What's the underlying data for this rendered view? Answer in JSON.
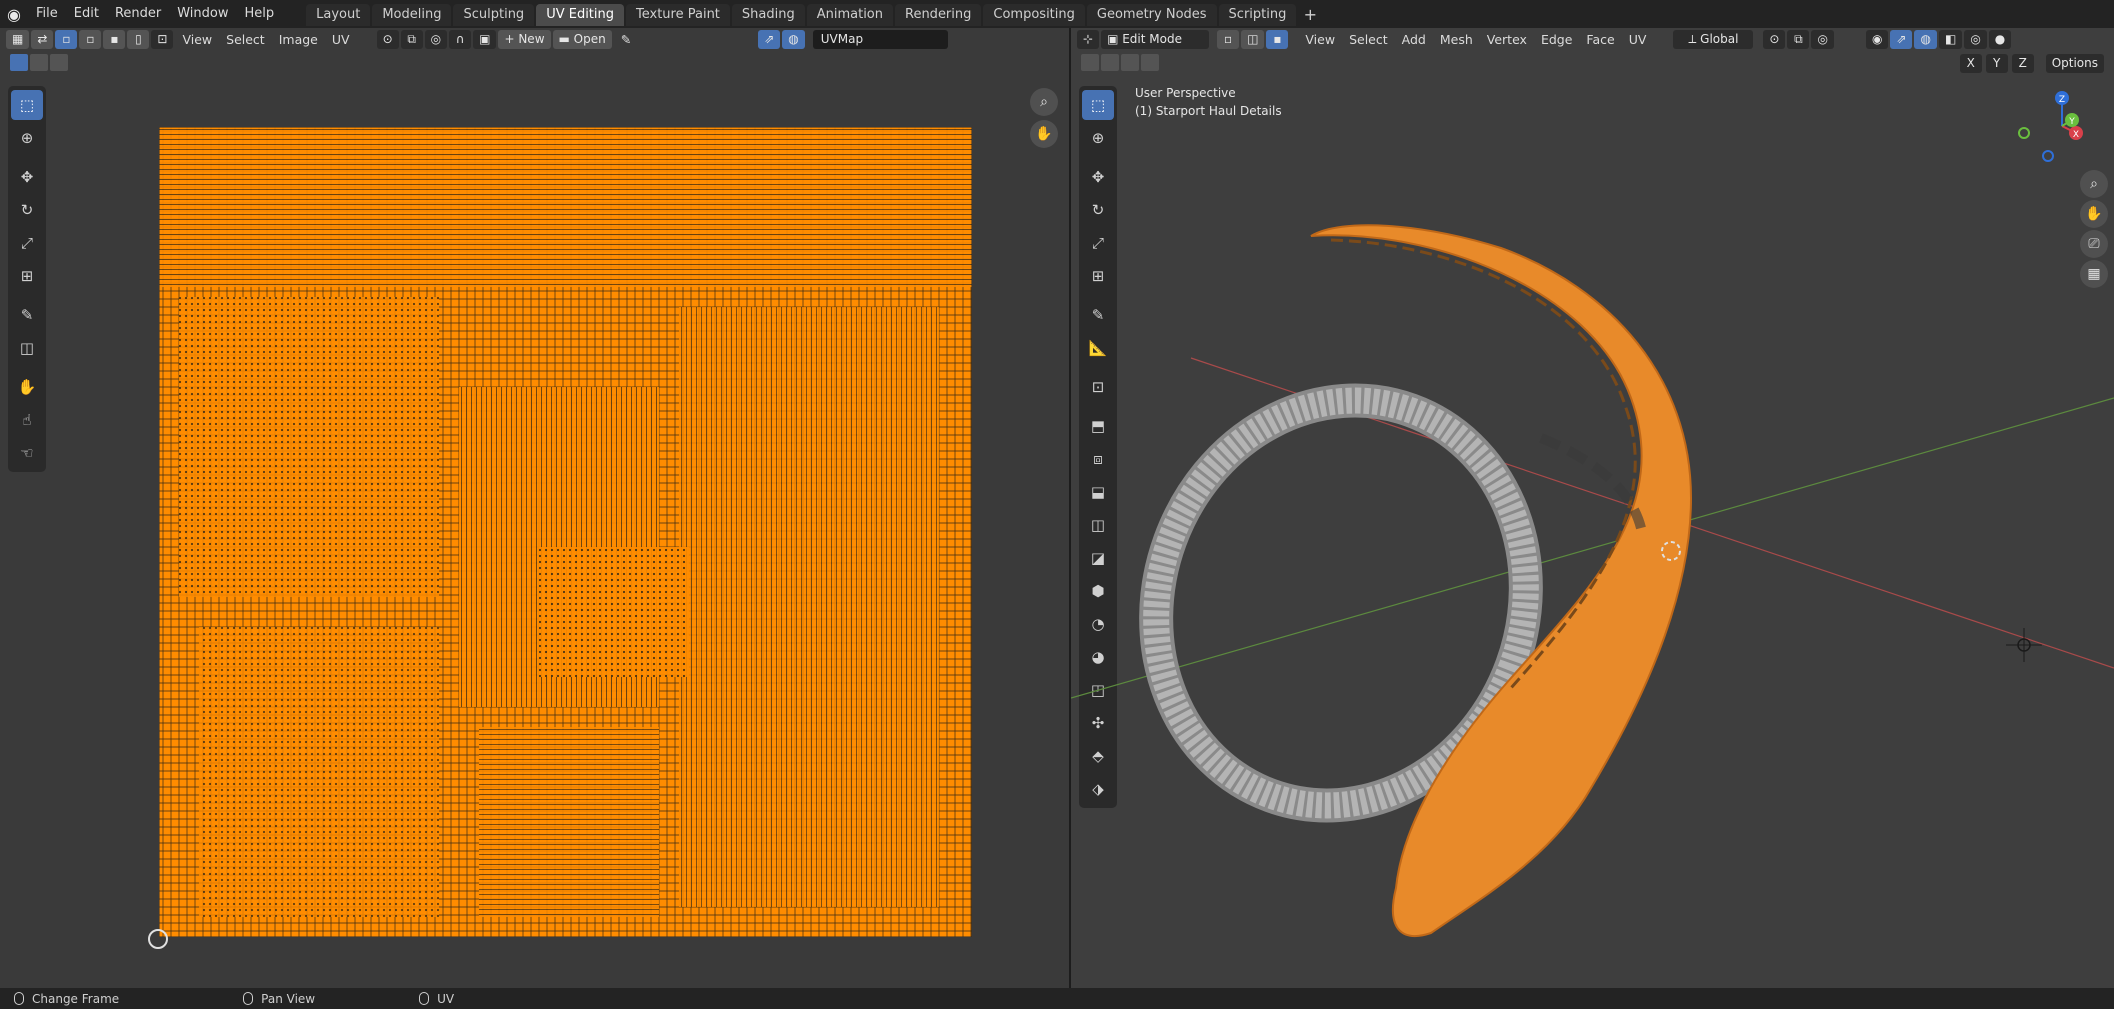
{
  "topbar": {
    "menu": [
      "File",
      "Edit",
      "Render",
      "Window",
      "Help"
    ],
    "workspaces": [
      "Layout",
      "Modeling",
      "Sculpting",
      "UV Editing",
      "Texture Paint",
      "Shading",
      "Animation",
      "Rendering",
      "Compositing",
      "Geometry Nodes",
      "Scripting"
    ],
    "active_workspace": "UV Editing",
    "add_tab": "+"
  },
  "uv_editor": {
    "menus": [
      "View",
      "Select",
      "Image",
      "UV"
    ],
    "new_label": "New",
    "open_label": "Open",
    "uv_map": "UVMap",
    "mesh_color": "#ff8c00"
  },
  "viewport": {
    "mode": "Edit Mode",
    "menus": [
      "View",
      "Select",
      "Add",
      "Mesh",
      "Vertex",
      "Edge",
      "Face",
      "UV"
    ],
    "orientation": "Global",
    "perspective_label": "User Perspective",
    "object_label": "(1) Starport Haul Details",
    "axis_buttons": [
      "X",
      "Y",
      "Z"
    ],
    "options_label": "Options",
    "gizmo": {
      "x": "X",
      "y": "Y",
      "z": "Z"
    }
  },
  "statusbar": {
    "items": [
      "Change Frame",
      "Pan View",
      "UV"
    ]
  },
  "colors": {
    "accent": "#4772b3",
    "selection": "#ff8c00",
    "background": "#3a3a3a"
  }
}
